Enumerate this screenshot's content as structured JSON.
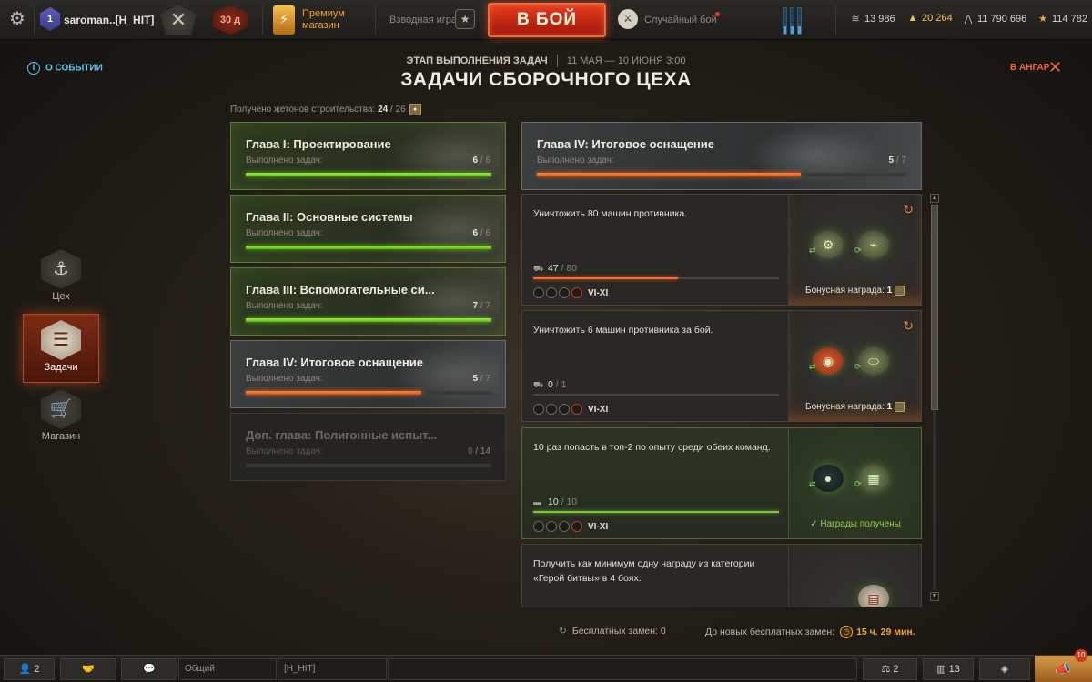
{
  "topbar": {
    "player_rank": "1",
    "player_name": "saroman..[H_HIT]",
    "days_badge": "30 д",
    "premium_label": "Премиум магазин",
    "platoon_label": "Взводная игра",
    "battle_button": "В БОЙ",
    "battle_mode": "Случайный бой",
    "currencies": [
      {
        "icon": "credits-icon",
        "value": "13 986"
      },
      {
        "icon": "gold-icon",
        "value": "20 264",
        "color": "#f5c04a"
      },
      {
        "icon": "free-xp-icon",
        "value": "11 790 696"
      },
      {
        "icon": "star-xp-icon",
        "value": "114 782"
      }
    ]
  },
  "header": {
    "about_event": "О СОБЫТИИ",
    "stage_label": "ЭТАП ВЫПОЛНЕНИЯ ЗАДАЧ",
    "stage_dates": "11 МАЯ — 10 ИЮНЯ 3:00",
    "title": "ЗАДАЧИ СБОРОЧНОГО ЦЕХА",
    "to_hangar": "В АНГАР"
  },
  "nav": [
    {
      "label": "Цех",
      "icon": "crane-hook-icon"
    },
    {
      "label": "Задачи",
      "icon": "task-list-icon",
      "active": true
    },
    {
      "label": "Магазин",
      "icon": "shopping-cart-icon"
    }
  ],
  "tokens": {
    "label": "Получено жетонов строительства:",
    "value": "24",
    "total": "26"
  },
  "chapters": [
    {
      "title": "Глава I: Проектирование",
      "sub": "Выполнено задач:",
      "done": "6",
      "total": "6",
      "progress": 1.0
    },
    {
      "title": "Глава II: Основные системы",
      "sub": "Выполнено задач:",
      "done": "6",
      "total": "6",
      "progress": 1.0
    },
    {
      "title": "Глава III: Вспомогательные си...",
      "sub": "Выполнено задач:",
      "done": "7",
      "total": "7",
      "progress": 1.0
    },
    {
      "title": "Глава IV: Итоговое оснащение",
      "sub": "Выполнено задач:",
      "done": "5",
      "total": "7",
      "progress": 0.714
    },
    {
      "title": "Доп. глава: Полигонные испыт...",
      "sub": "Выполнено задач:",
      "done": "0",
      "total": "14",
      "progress": 0
    }
  ],
  "current_chapter": {
    "title": "Глава IV: Итоговое оснащение",
    "sub": "Выполнено задач:",
    "done": "5",
    "total": "7",
    "progress": 0.714
  },
  "tasks": [
    {
      "desc": "Уничтожить 80 машин противника.",
      "current": "47",
      "total": "80",
      "progress": 0.5875,
      "tiers": "VI-XI",
      "bonus_label": "Бонусная награда:",
      "bonus_value": "1",
      "status": "active"
    },
    {
      "desc": "Уничтожить 6 машин противника за бой.",
      "current": "0",
      "total": "1",
      "progress": 0.0,
      "tiers": "VI-XI",
      "bonus_label": "Бонусная награда:",
      "bonus_value": "1",
      "status": "active"
    },
    {
      "desc": "10 раз попасть в топ-2 по опыту среди обеих команд.",
      "current": "10",
      "total": "10",
      "progress": 1.0,
      "tiers": "VI-XI",
      "claimed_label": "✓ Награды получены",
      "status": "done"
    },
    {
      "desc": "Получить как минимум одну награду из категории «Герой битвы» в 4 боях.",
      "status": "active"
    }
  ],
  "footer": {
    "free_swaps": "Бесплатных замен: 0",
    "next_swaps_label": "До новых бесплатных замен:",
    "next_swaps_time": "15 ч. 29 мин."
  },
  "bottombar": {
    "friends_count": "2",
    "chat_channel": "Общий",
    "clan_channel": "[H_HIT]",
    "scales_count": "2",
    "stats_count": "13",
    "notifications": "10"
  }
}
